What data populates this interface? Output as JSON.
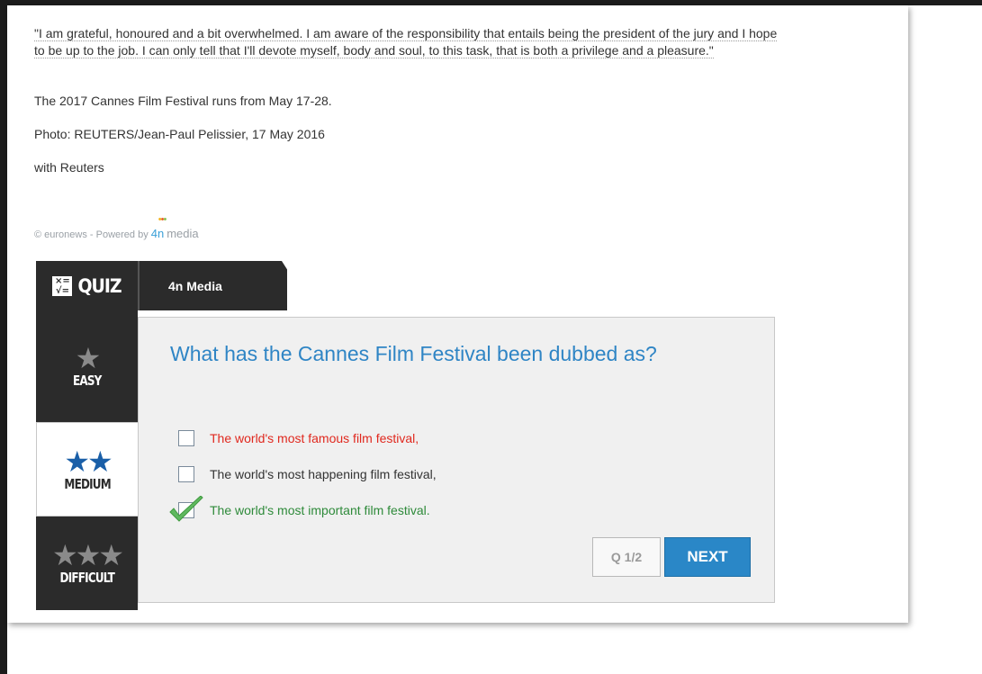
{
  "article": {
    "quote": "\"I am grateful, honoured and a bit overwhelmed. I am aware of the responsibility that entails being the president of the jury and I hope to be up to the job. I can only tell that I'll devote myself, body and soul, to this task, that is both a privilege and a pleasure.\"",
    "festival_dates": "The 2017 Cannes Film Festival runs from May 17-28.",
    "photo_credit": "Photo: REUTERS/Jean-Paul Pelissier, 17 May 2016",
    "source": "with Reuters"
  },
  "credit": {
    "prefix": "© euronews - Powered by",
    "brand_4n": "4n",
    "brand_media": "media"
  },
  "quiz": {
    "brand_label": "QUIZ",
    "tab_label": "4n Media",
    "levels": [
      {
        "label": "EASY",
        "stars": "★",
        "active": false
      },
      {
        "label": "MEDIUM",
        "stars": "★★",
        "active": true
      },
      {
        "label": "DIFFICULT",
        "stars": "★★★",
        "active": false
      }
    ],
    "question": "What has the Cannes Film Festival been dubbed as?",
    "answers": [
      {
        "text": "The world's most famous film festival,",
        "state": "wrong"
      },
      {
        "text": "The world's most happening film festival,",
        "state": "neutral"
      },
      {
        "text": "The world's most important film festival.",
        "state": "correct"
      }
    ],
    "counter": "Q 1/2",
    "next_label": "NEXT"
  },
  "colors": {
    "question_blue": "#2f85c5",
    "wrong_red": "#e0281e",
    "correct_green": "#2e8a3a",
    "dark_panel": "#2b2b2b",
    "next_button": "#2a87c7"
  }
}
